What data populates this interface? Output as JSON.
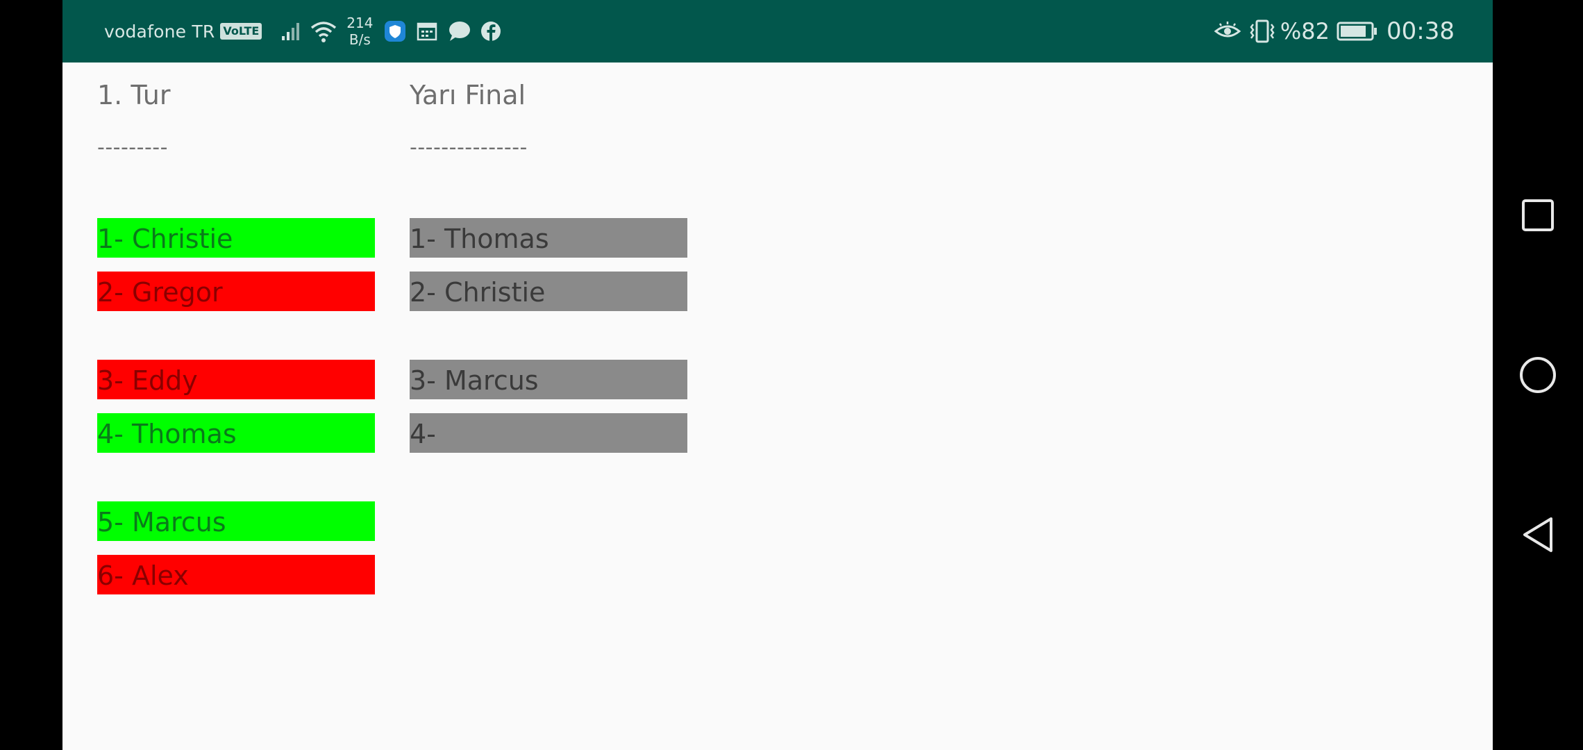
{
  "status_bar": {
    "carrier": "vodafone TR",
    "volte": "VoLTE",
    "speed_value": "214",
    "speed_unit": "B/s",
    "battery": "%82",
    "time": "00:38",
    "icons_left": [
      "signal-icon",
      "wifi-icon",
      "shield-app-icon",
      "calendar-icon",
      "chat-bubble-icon",
      "facebook-icon"
    ],
    "icons_right": [
      "eye-icon",
      "vibrate-icon",
      "battery-icon"
    ],
    "background": "#02574c"
  },
  "bracket": {
    "round1": {
      "title": "1. Tur",
      "divider": "---------",
      "players": [
        {
          "label": "1- Christie",
          "status": "winner"
        },
        {
          "label": "2- Gregor",
          "status": "loser"
        },
        {
          "label": "3- Eddy",
          "status": "loser"
        },
        {
          "label": "4- Thomas",
          "status": "winner"
        },
        {
          "label": "5- Marcus",
          "status": "winner"
        },
        {
          "label": "6- Alex",
          "status": "loser"
        }
      ]
    },
    "semifinal": {
      "title": "Yarı Final",
      "divider": "---------------",
      "players": [
        {
          "label": "1- Thomas",
          "status": "pending"
        },
        {
          "label": "2- Christie",
          "status": "pending"
        },
        {
          "label": "3- Marcus",
          "status": "pending"
        },
        {
          "label": "4-",
          "status": "pending"
        }
      ]
    }
  },
  "colors": {
    "winner": "#00ff00",
    "loser": "#ff0000",
    "pending": "#8a8a8a"
  },
  "nav_bar": {
    "buttons": [
      "recents-square-icon",
      "home-circle-icon",
      "back-triangle-icon"
    ]
  }
}
